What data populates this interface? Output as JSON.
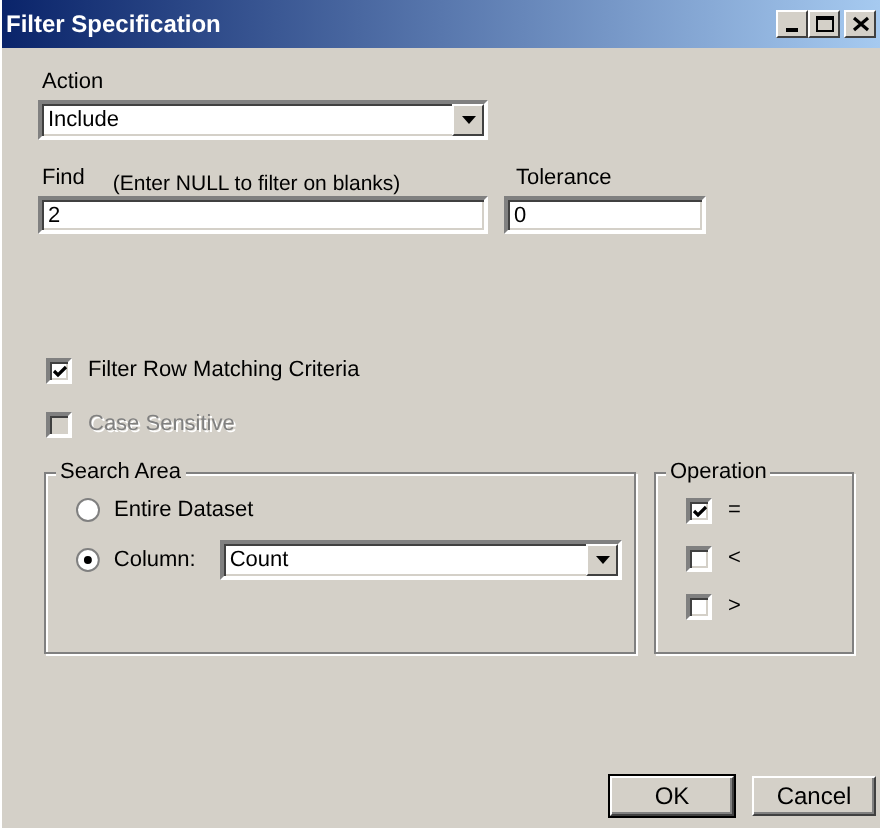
{
  "window": {
    "title": "Filter Specification"
  },
  "action": {
    "label": "Action",
    "value": "Include"
  },
  "find": {
    "label": "Find",
    "hint": "(Enter NULL to filter on blanks)",
    "value": "2"
  },
  "tolerance": {
    "label": "Tolerance",
    "value": "0"
  },
  "options": [
    {
      "label": "Filter Row Matching Criteria",
      "checked": true,
      "disabled": false
    },
    {
      "label": "Case Sensitive",
      "checked": false,
      "disabled": true
    }
  ],
  "search_area": {
    "title": "Search Area",
    "choices": [
      {
        "label": "Entire Dataset",
        "selected": false
      },
      {
        "label": "Column:",
        "selected": true
      }
    ],
    "column": {
      "value": "Count"
    }
  },
  "operation": {
    "title": "Operation",
    "items": [
      {
        "label": "=",
        "checked": true
      },
      {
        "label": "<",
        "checked": false
      },
      {
        "label": ">",
        "checked": false
      }
    ]
  },
  "buttons": [
    {
      "label": "OK",
      "default": true
    },
    {
      "label": "Cancel",
      "default": false
    }
  ]
}
